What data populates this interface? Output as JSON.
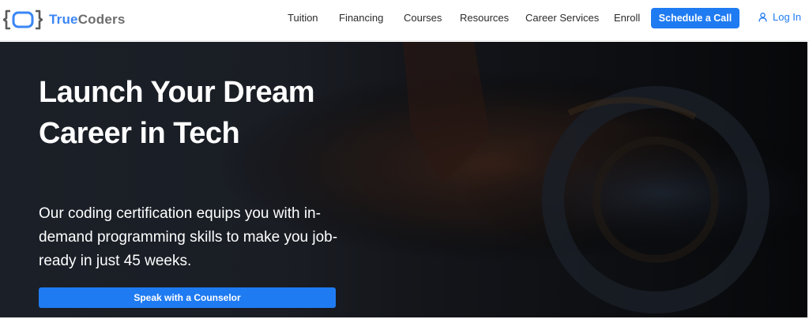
{
  "brand": {
    "name_part1": "True",
    "name_part2": "Coders",
    "accent": "#1f7bf2"
  },
  "nav": {
    "items": [
      {
        "label": "Tuition"
      },
      {
        "label": "Financing"
      },
      {
        "label": "Courses"
      },
      {
        "label": "Resources"
      },
      {
        "label": "Career Services"
      },
      {
        "label": "Enroll"
      }
    ],
    "cta_label": "Schedule a Call",
    "login_label": "Log In",
    "login_icon": "user-icon"
  },
  "hero": {
    "title": "Launch Your Dream Career in Tech",
    "subtitle": "Our coding certification equips you with in-demand programming skills to make you job-ready in just 45 weeks.",
    "button_label": "Speak with a Counselor"
  }
}
